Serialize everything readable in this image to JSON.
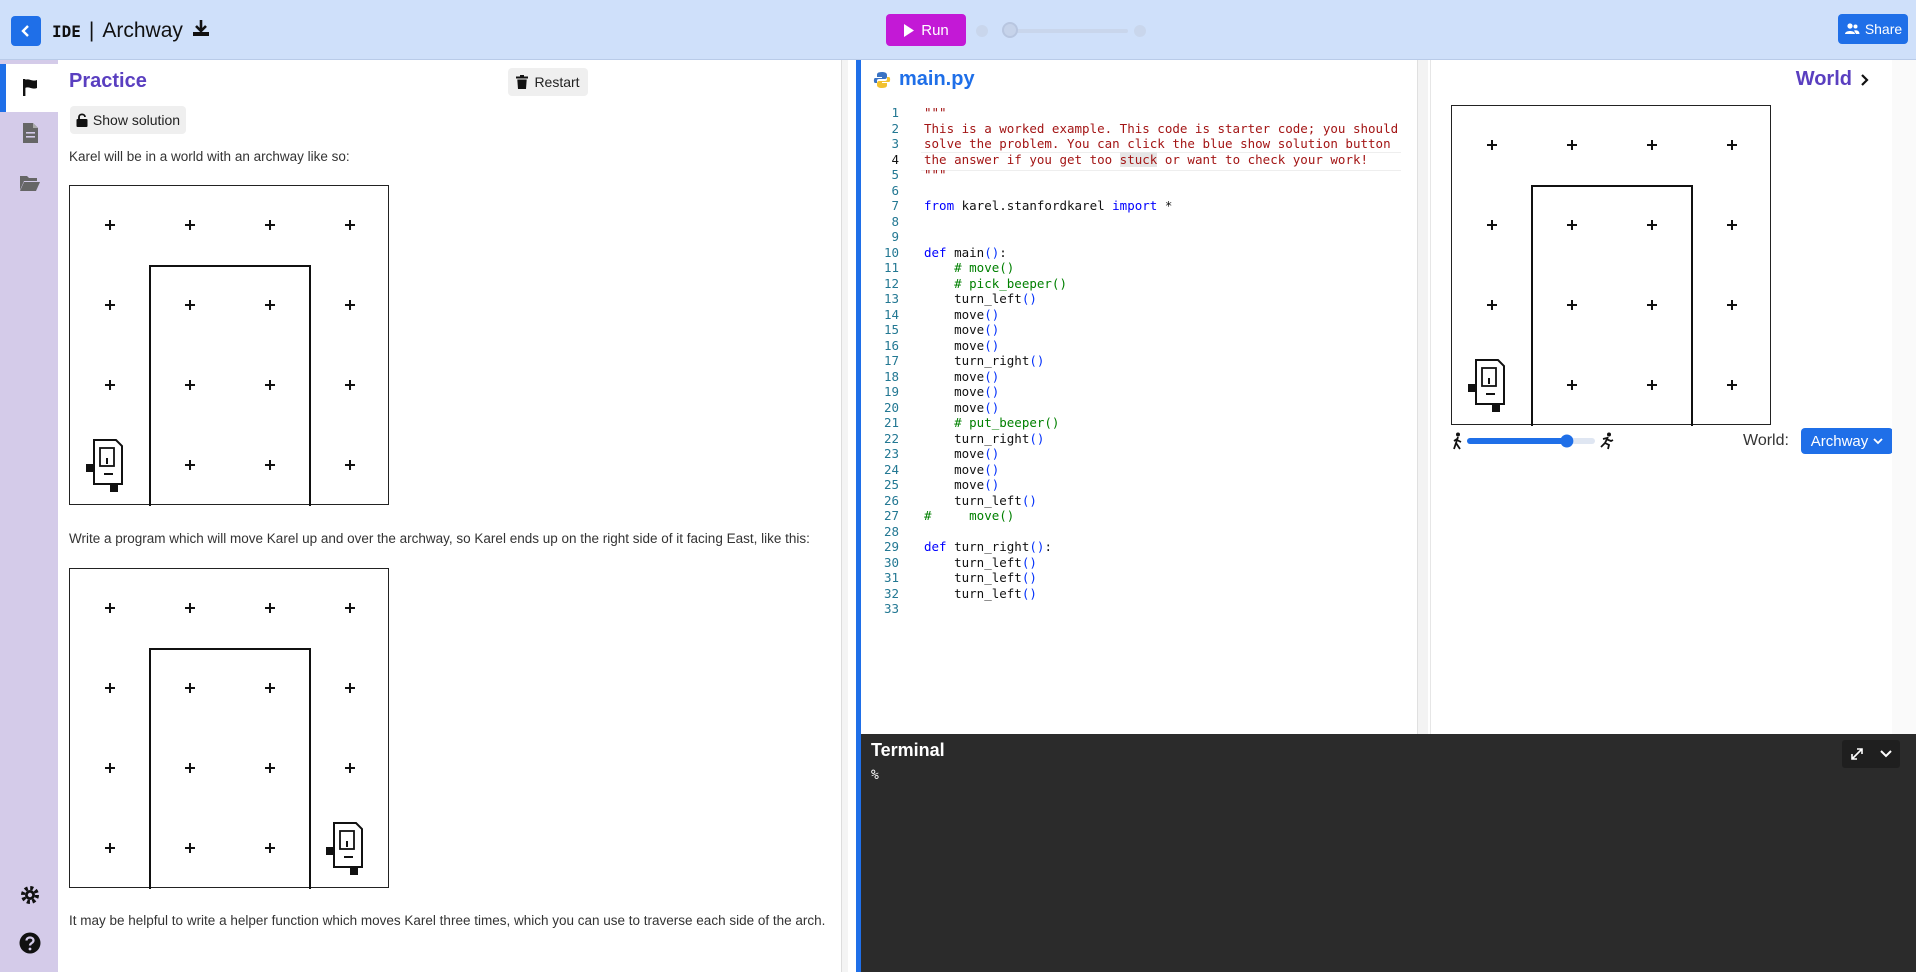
{
  "topbar": {
    "app": "IDE",
    "separator": "|",
    "project": "Archway",
    "run_label": "Run",
    "share_label": "Share"
  },
  "instructions": {
    "title": "Practice",
    "restart_label": "Restart",
    "show_solution_label": "Show solution",
    "para1": "Karel will be in a world with an archway like so:",
    "para2": "Write a program which will move Karel up and over the archway, so Karel ends up on the right side of it facing East, like this:",
    "para3": "It may be helpful to write a helper function which moves Karel three times, which you can use to traverse each side of the arch."
  },
  "editor": {
    "filename": "main.py",
    "current_line": 4,
    "lines": [
      "\"\"\"",
      "This is a worked example. This code is starter code; you should",
      "solve the problem. You can click the blue show solution button",
      "the answer if you get too stuck or want to check your work!",
      "\"\"\"",
      "",
      "from karel.stanfordkarel import *",
      "",
      "",
      "def main():",
      "    # move()",
      "    # pick_beeper()",
      "    turn_left()",
      "    move()",
      "    move()",
      "    move()",
      "    turn_right()",
      "    move()",
      "    move()",
      "    move()",
      "    # put_beeper()",
      "    turn_right()",
      "    move()",
      "    move()",
      "    move()",
      "    turn_left()",
      "#     move()",
      "",
      "def turn_right():",
      "    turn_left()",
      "    turn_left()",
      "    turn_left()",
      ""
    ]
  },
  "world": {
    "title": "World",
    "world_label": "World:",
    "selected_world": "Archway",
    "speed_fraction": 0.78
  },
  "terminal": {
    "title": "Terminal",
    "prompt": "%"
  }
}
